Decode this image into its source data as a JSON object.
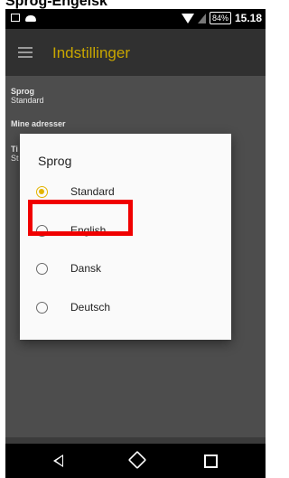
{
  "header_fragment": "Sprog-Engelsk",
  "statusbar": {
    "battery": "84%",
    "time": "15.18"
  },
  "appbar": {
    "title": "Indstillinger"
  },
  "settings": {
    "language_label": "Sprog",
    "language_value": "Standard",
    "addresses_label": "Mine adresser",
    "hidden_label_prefix": "Ti",
    "hidden_value_prefix": "St"
  },
  "dialog": {
    "title": "Sprog",
    "options": [
      {
        "label": "Standard",
        "selected": true
      },
      {
        "label": "English",
        "selected": false
      },
      {
        "label": "Dansk",
        "selected": false
      },
      {
        "label": "Deutsch",
        "selected": false
      }
    ]
  },
  "colors": {
    "accent": "#e3b400",
    "highlight": "#f00000",
    "appbar_title": "#c8a600"
  }
}
